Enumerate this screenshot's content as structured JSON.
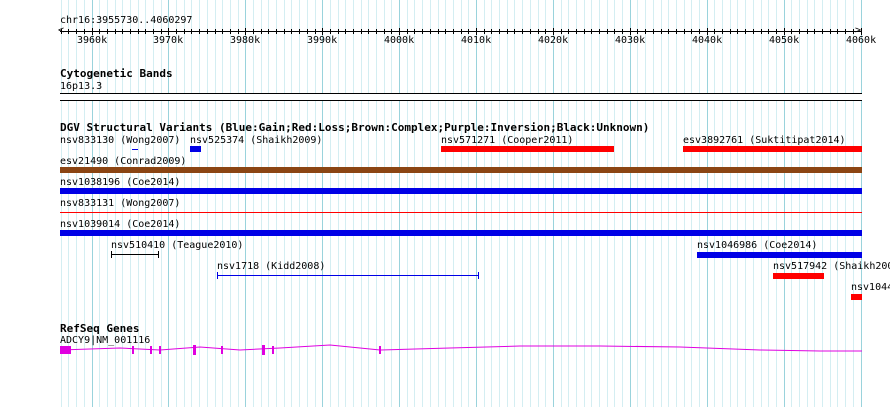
{
  "colors": {
    "gain": "#0000e6",
    "loss": "#ff0000",
    "complex": "#8b4513",
    "refseq": "#e000e0",
    "grid_major": "#9ad3dc",
    "grid_minor": "#d4eef2"
  },
  "ruler": {
    "position_label": "chr16:3955730..4060297",
    "ticks": [
      "3960k",
      "3970k",
      "3980k",
      "3990k",
      "4000k",
      "4010k",
      "4020k",
      "4030k",
      "4040k",
      "4050k",
      "4060k"
    ]
  },
  "cytoband": {
    "title": "Cytogenetic Bands",
    "band_label": "16p13.3"
  },
  "dgv": {
    "title": "DGV Structural Variants (Blue:Gain;Red:Loss;Brown:Complex;Purple:Inversion;Black:Unknown)",
    "variants": [
      {
        "label": "nsv833130 (Wong2007)",
        "color": "gain"
      },
      {
        "label": "nsv525374 (Shaikh2009)",
        "color": "gain"
      },
      {
        "label": "nsv571271 (Cooper2011)",
        "color": "loss"
      },
      {
        "label": "esv3892761 (Suktitipat2014)",
        "color": "loss"
      },
      {
        "label": "esv21490 (Conrad2009)",
        "color": "complex"
      },
      {
        "label": "nsv1038196 (Coe2014)",
        "color": "gain"
      },
      {
        "label": "nsv833131 (Wong2007)",
        "color": "loss"
      },
      {
        "label": "nsv1039014 (Coe2014)",
        "color": "gain"
      },
      {
        "label": "nsv510410 (Teague2010)",
        "color": "unknown"
      },
      {
        "label": "nsv1046986 (Coe2014)",
        "color": "gain"
      },
      {
        "label": "nsv1718 (Kidd2008)",
        "color": "gain"
      },
      {
        "label": "nsv517942 (Shaikh200",
        "color": "loss"
      },
      {
        "label": "nsv1044",
        "color": "loss"
      }
    ]
  },
  "refseq": {
    "title": "RefSeq Genes",
    "gene_label": "ADCY9|NM_001116"
  }
}
